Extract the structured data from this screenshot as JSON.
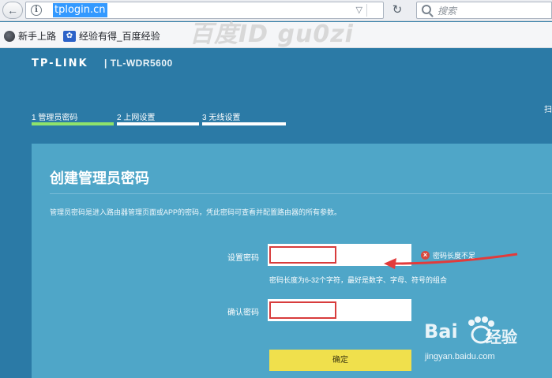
{
  "browser": {
    "url": "tplogin.cn",
    "search_placeholder": "搜索",
    "bookmarks": [
      "新手上路",
      "经验有得_百度经验"
    ],
    "watermark": "百度ID gu0zi"
  },
  "router": {
    "brand": "TP-LINK",
    "model": "| TL-WDR5600",
    "steps": [
      {
        "label": "1 管理员密码",
        "active": true
      },
      {
        "label": "2 上网设置",
        "active": false
      },
      {
        "label": "3 无线设置",
        "active": false
      }
    ],
    "edge_text": "扫",
    "colors": {
      "background": "#2b7aa6",
      "card": "#4fa6c8",
      "active_step": "#8fe36b",
      "button": "#f0e04c",
      "error": "#d9493f"
    }
  },
  "card": {
    "title": "创建管理员密码",
    "description": "管理员密码是进入路由器管理页面或APP的密码，凭此密码可查看并配置路由器的所有参数。",
    "password_label": "设置密码",
    "password_value": "",
    "error_text": "密码长度不足",
    "hint": "密码长度为6-32个字符，最好是数字、字母、符号的组合",
    "confirm_label": "确认密码",
    "confirm_value": "",
    "button_label": "确定"
  },
  "watermark": {
    "logo": "Bai",
    "product": "经验",
    "url": "jingyan.baidu.com"
  }
}
